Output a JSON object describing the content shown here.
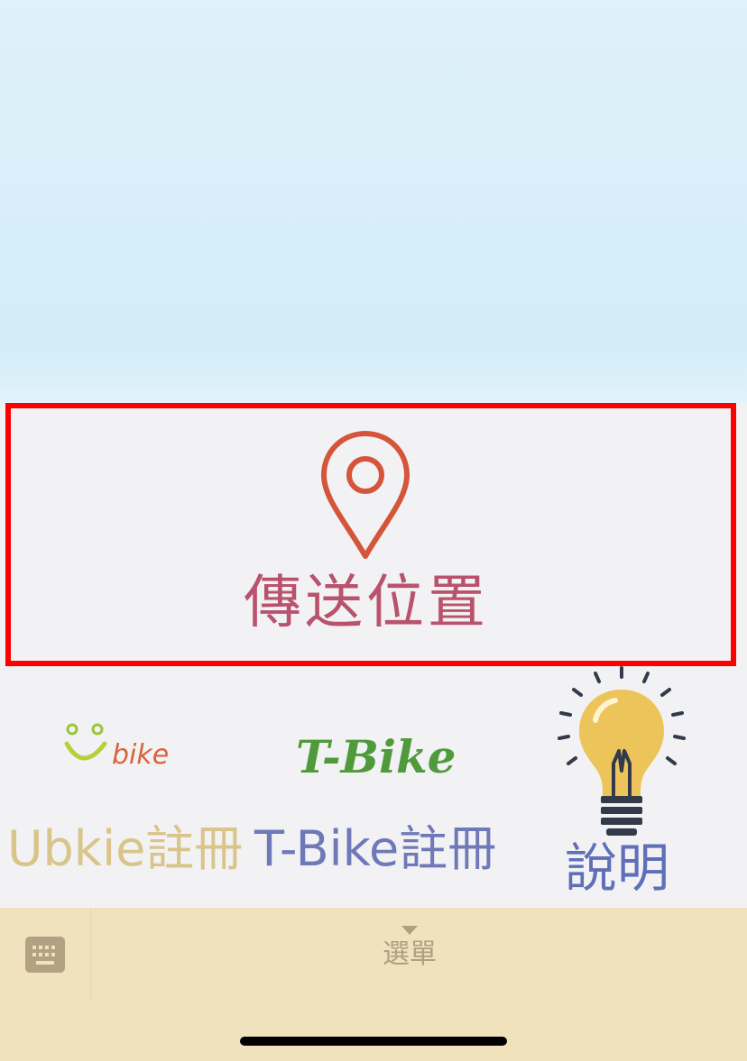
{
  "rich_menu": {
    "send_location": {
      "label": "傳送位置",
      "icon": "location-pin-icon",
      "highlight_color": "#ff0000",
      "icon_color": "#d4553a",
      "label_color": "#b9526c"
    },
    "ubike": {
      "logo_text": "bike",
      "label": "Ubkie註冊",
      "label_color": "#d9c48a"
    },
    "tbike": {
      "logo_text": "T-Bike",
      "label": "T-Bike註冊",
      "label_color": "#6f79b8"
    },
    "help": {
      "icon": "lightbulb-icon",
      "label": "說明",
      "label_color": "#5f6fb8"
    }
  },
  "bottom_bar": {
    "keyboard_icon": "keyboard-icon",
    "menu_label": "選單",
    "menu_arrow": "triangle-down-icon",
    "background": "#f0e2bd"
  }
}
